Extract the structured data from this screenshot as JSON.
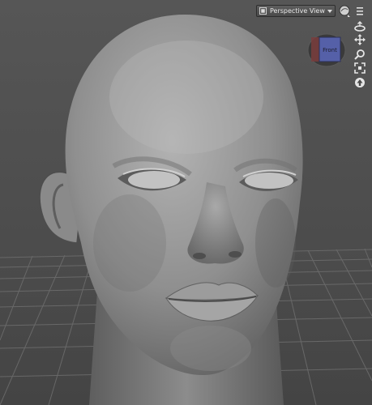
{
  "viewport": {
    "view_select": {
      "selected": "Perspective View"
    },
    "view_cube": {
      "face_label": "Front"
    }
  },
  "icons": [
    "camera-icon",
    "shading-sphere-icon",
    "menu-icon",
    "orbit-icon",
    "pan-icon",
    "zoom-icon",
    "frame-icon",
    "reset-view-icon"
  ],
  "colors": {
    "cube_front": "#5560a8",
    "cube_side": "#7a3d3d",
    "grid_line": "#6e6e6e",
    "viewport_bg": "#4a4a4a"
  }
}
